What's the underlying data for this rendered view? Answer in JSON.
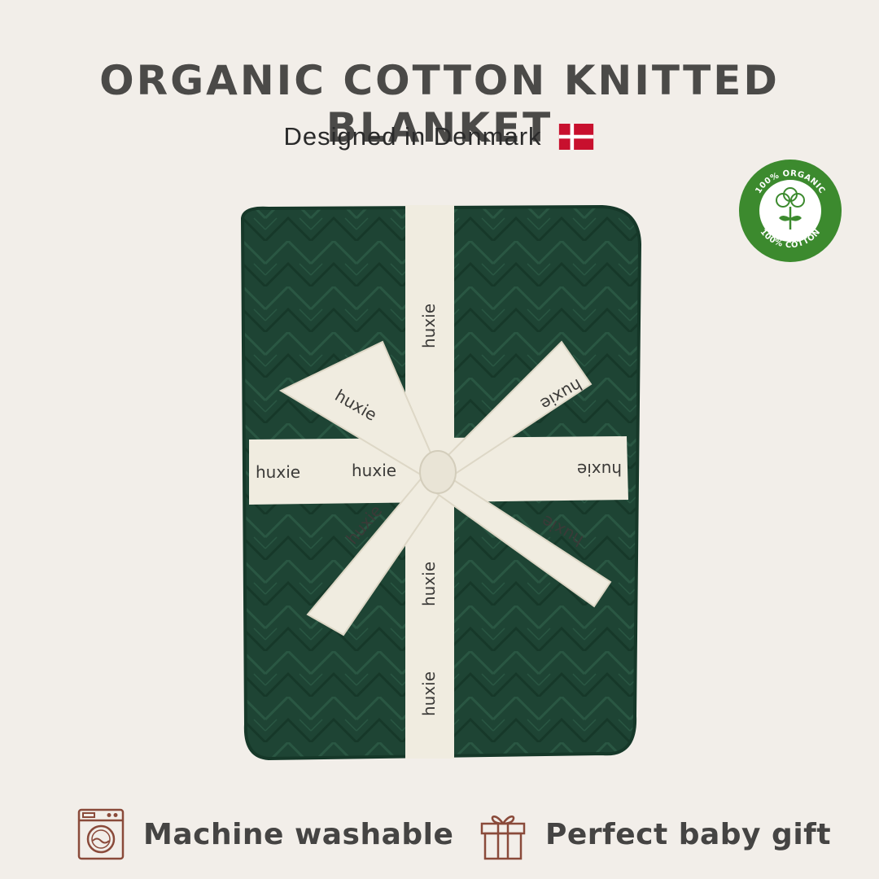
{
  "header": {
    "title": "ORGANIC COTTON KNITTED BLANKET",
    "subtitle": "Designed in Denmark"
  },
  "badge": {
    "top_text": "100% ORGANIC",
    "bottom_text": "100% COTTON",
    "color": "#3c8a2e"
  },
  "product": {
    "blanket_color": "#1e4434",
    "ribbon_color": "#f0ece0",
    "ribbon_brand": "huxie"
  },
  "features": [
    {
      "label": "Machine washable",
      "icon": "washing-machine-icon"
    },
    {
      "label": "Perfect baby gift",
      "icon": "gift-box-icon"
    }
  ],
  "colors": {
    "background": "#f2eee9",
    "icon_accent": "#8a4a3a",
    "denmark_red": "#c8102e"
  }
}
